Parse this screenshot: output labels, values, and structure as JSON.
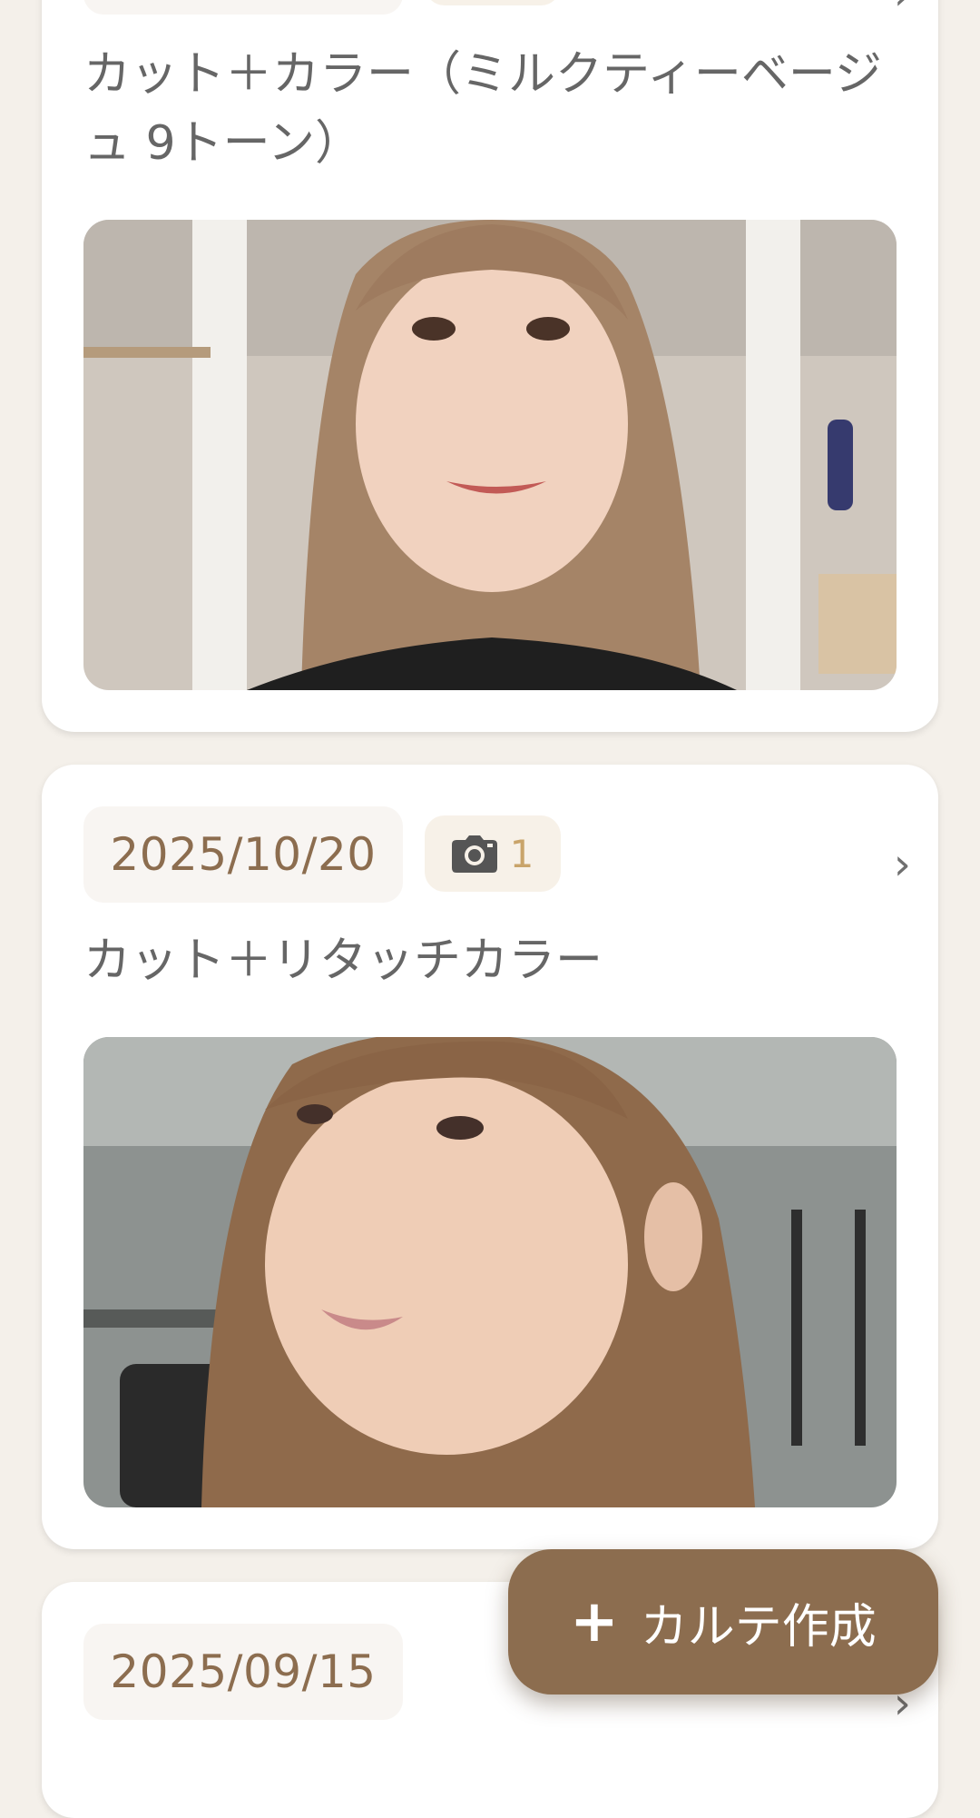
{
  "records": [
    {
      "date": "",
      "title": "カット＋カラー（ミルクティーベージュ 9トーン）",
      "photo_count": ""
    },
    {
      "date": "2025/10/20",
      "title": "カット＋リタッチカラー",
      "photo_count": "1"
    },
    {
      "date": "2025/09/15",
      "title": "",
      "photo_count": ""
    }
  ],
  "icons": {
    "camera": "camera-icon",
    "chevron": "chevron-right-icon",
    "plus": "plus-icon"
  },
  "chevron_glyph": "›",
  "fab": {
    "plus_glyph": "+",
    "label": "カルテ作成"
  },
  "colors": {
    "accent": "#8c6d4f",
    "background": "#f4f0ea",
    "card": "#ffffff",
    "count": "#c9a46a",
    "text": "#666666"
  }
}
